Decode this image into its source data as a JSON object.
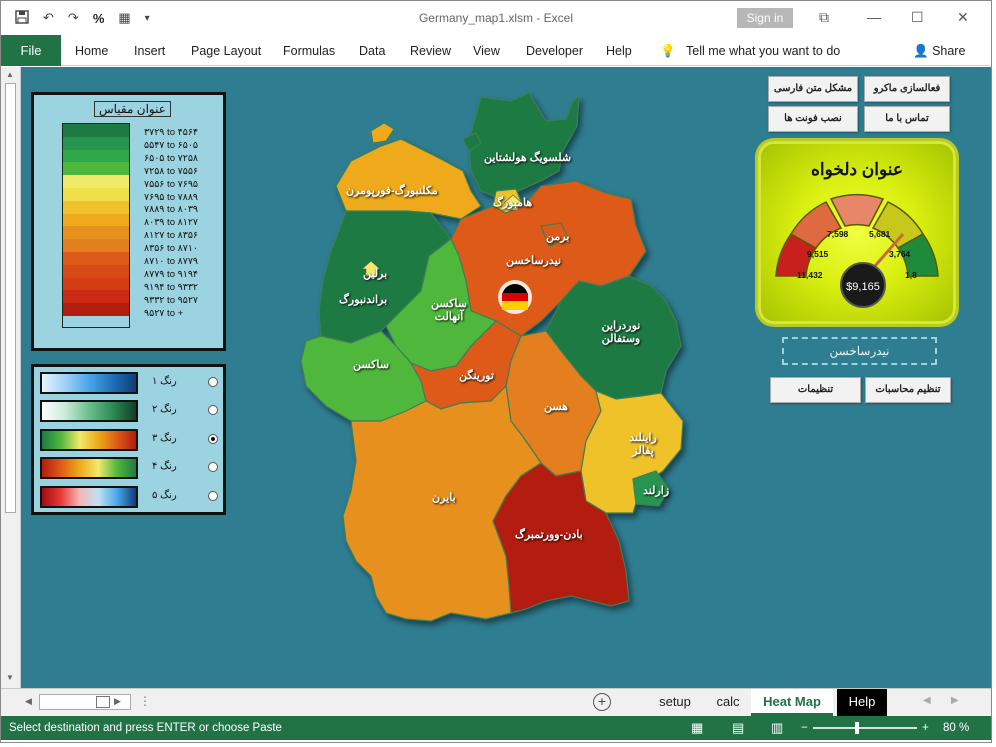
{
  "window": {
    "title": "Germany_map1.xlsm  -  Excel",
    "signin": "Sign in",
    "percent_btn": "%"
  },
  "ribbon": {
    "file": "File",
    "tabs": [
      "Home",
      "Insert",
      "Page Layout",
      "Formulas",
      "Data",
      "Review",
      "View",
      "Developer",
      "Help"
    ],
    "tell_me": "Tell me what you want to do",
    "share": "Share"
  },
  "legend": {
    "title": "عنوان مقیاس",
    "colors": [
      "#1e7a43",
      "#27954f",
      "#2fa84c",
      "#4fb83c",
      "#f2e96a",
      "#efe04a",
      "#efc22a",
      "#eeaa1a",
      "#e8901e",
      "#e47f1f",
      "#dd5a18",
      "#d64a16",
      "#d33c15",
      "#cc2a12",
      "#b21d0f"
    ],
    "ranges": [
      "۳۷۲۹ to ۴۵۶۴",
      "۵۵۴۷ to ۶۵۰۵",
      "۶۵۰۵ to ۷۲۵۸",
      "۷۲۵۸ to ۷۵۵۶",
      "۷۵۵۶ to ۷۶۹۵",
      "۷۶۹۵ to ۷۸۸۹",
      "۷۸۸۹ to ۸۰۳۹",
      "۸۰۳۹ to ۸۱۲۷",
      "۸۱۲۷ to ۸۳۵۶",
      "۸۳۵۶ to ۸۷۱۰",
      "۸۷۱۰ to ۸۷۷۹",
      "۸۷۷۹ to ۹۱۹۴",
      "۹۱۹۴ to ۹۳۳۲",
      "۹۳۳۲ to ۹۵۲۷",
      "۹۵۲۷ to +"
    ]
  },
  "palettes": [
    {
      "label": "رنگ ۱",
      "selected": false,
      "gradient": "linear-gradient(90deg,#e8f4ff,#9fd0f5,#4aa6e8,#1f6fb8,#0d3e78)"
    },
    {
      "label": "رنگ ۲",
      "selected": false,
      "gradient": "linear-gradient(90deg,#ffffff,#c8ead8,#6bbf8c,#2e8b57,#123d25)"
    },
    {
      "label": "رنگ ۳",
      "selected": true,
      "gradient": "linear-gradient(90deg,#1e7a43,#4fb83c,#f2e96a,#eeaa1a,#dd5a18,#b21d0f)"
    },
    {
      "label": "رنگ ۴",
      "selected": false,
      "gradient": "linear-gradient(90deg,#b21d0f,#dd5a18,#eeaa1a,#f2e96a,#4fb83c,#1e7a43)"
    },
    {
      "label": "رنگ ۵",
      "selected": false,
      "gradient": "linear-gradient(90deg,#9e0d12,#e83a3a,#f7b6b6,#bfe1f5,#4aa6e8,#0d3e78)"
    }
  ],
  "buttons": {
    "macro": "فعالسازی ماکرو",
    "persian_text": "مشکل متن فارسی",
    "contact": "تماس با ما",
    "install_font": "نصب فونت ها",
    "calc_settings": "تنظیم محاسبات",
    "settings": "تنظیمات"
  },
  "gauge": {
    "title": "عنوان دلخواه",
    "value": "$9,165",
    "ticks": [
      "11,432",
      "9,515",
      "7,598",
      "5,681",
      "3,764",
      "1,8"
    ]
  },
  "selected_region": "نیدرساخسن",
  "map": {
    "regions": [
      {
        "name": "شلسویگ هولشتاین",
        "color": "#1e7a43"
      },
      {
        "name": "هامبورگ",
        "color": "#efc22a"
      },
      {
        "name": "مکلنبورگ-فورپومرن",
        "color": "#eeaa1a"
      },
      {
        "name": "برمن",
        "color": "#dd5a18"
      },
      {
        "name": "نیدرساخسن",
        "color": "#dd5a18"
      },
      {
        "name": "برلین",
        "color": "#efc22a"
      },
      {
        "name": "براندنبورگ",
        "color": "#1e7a43"
      },
      {
        "name": "ساکسن آنهالت",
        "color": "#4fb83c"
      },
      {
        "name": "نوردراین وستفالن",
        "color": "#1e7a43"
      },
      {
        "name": "ساکسن",
        "color": "#4fb83c"
      },
      {
        "name": "تورینگن",
        "color": "#dd5a18"
      },
      {
        "name": "هسن",
        "color": "#e47f1f"
      },
      {
        "name": "راینلند پفالز",
        "color": "#efc22a"
      },
      {
        "name": "زارلند",
        "color": "#27954f"
      },
      {
        "name": "بایرن",
        "color": "#e8901e"
      },
      {
        "name": "بادن-وورتمبرگ",
        "color": "#b21d0f"
      }
    ]
  },
  "sheet_tabs": [
    "setup",
    "calc",
    "Heat Map",
    "Help"
  ],
  "status": {
    "message": "Select destination and press ENTER or choose Paste",
    "zoom": "80 %"
  }
}
